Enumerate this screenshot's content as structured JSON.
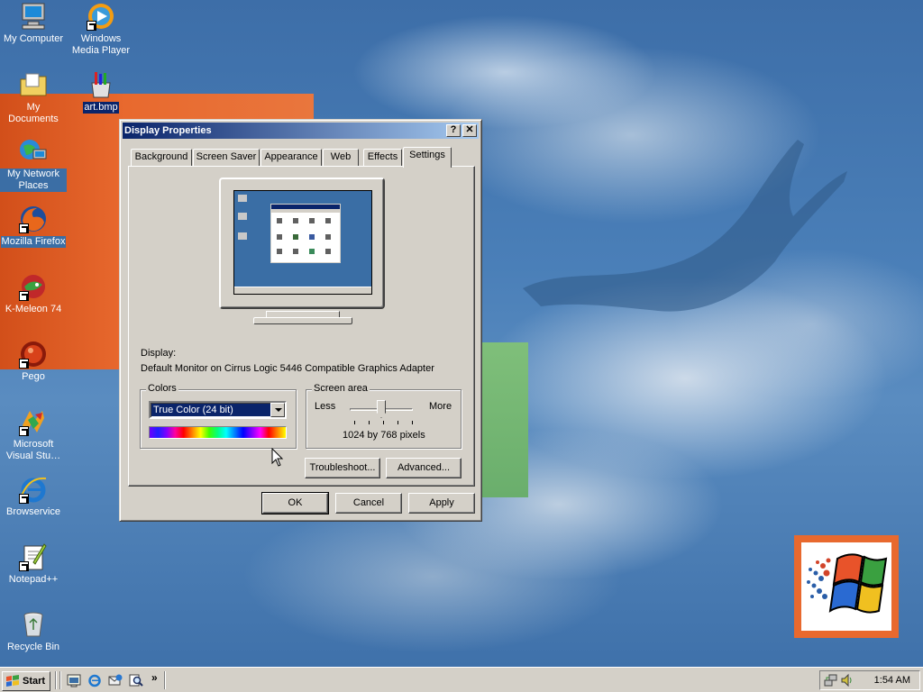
{
  "desktop": {
    "icons": [
      {
        "label": "My Computer",
        "icon": "my-computer-icon"
      },
      {
        "label": "Windows Media Player",
        "icon": "media-player-icon"
      },
      {
        "label": "My Documents",
        "icon": "my-documents-icon"
      },
      {
        "label": "art.bmp",
        "icon": "paint-bitmap-icon"
      },
      {
        "label": "My Network Places",
        "icon": "network-places-icon"
      },
      {
        "label": "Mozilla Firefox",
        "icon": "firefox-icon"
      },
      {
        "label": "K-Meleon 74",
        "icon": "k-meleon-icon"
      },
      {
        "label": "Pego",
        "icon": "pego-icon"
      },
      {
        "label": "Microsoft Visual Stu…",
        "icon": "visual-studio-icon"
      },
      {
        "label": "Browservice",
        "icon": "internet-explorer-icon"
      },
      {
        "label": "Notepad++",
        "icon": "notepad-plus-plus-icon"
      },
      {
        "label": "Recycle Bin",
        "icon": "recycle-bin-icon"
      }
    ]
  },
  "dialog": {
    "title": "Display Properties",
    "help_label": "?",
    "close_label": "✕",
    "tabs": [
      {
        "label": "Background"
      },
      {
        "label": "Screen Saver"
      },
      {
        "label": "Appearance"
      },
      {
        "label": "Web"
      },
      {
        "label": "Effects"
      },
      {
        "label": "Settings",
        "active": true
      }
    ],
    "display_label": "Display:",
    "display_value": "Default Monitor on Cirrus Logic 5446 Compatible Graphics Adapter",
    "colors": {
      "legend": "Colors",
      "selected": "True Color (24 bit)"
    },
    "screen_area": {
      "legend": "Screen area",
      "less": "Less",
      "more": "More",
      "value_text": "1024 by 768 pixels"
    },
    "troubleshoot_label": "Troubleshoot...",
    "advanced_label": "Advanced...",
    "ok_label": "OK",
    "cancel_label": "Cancel",
    "apply_label": "Apply"
  },
  "taskbar": {
    "start_label": "Start",
    "quick_launch": [
      "show-desktop-icon",
      "internet-explorer-icon",
      "outlook-express-icon",
      "search-icon"
    ],
    "more_label": "»",
    "clock": "1:54 AM"
  },
  "colors": {
    "desktop": "#3b6ea5",
    "window_face": "#d4d0c8",
    "title_active": "#0a246a",
    "title_gradient_end": "#a6caf0",
    "wallpaper_orange": "#e8692e"
  }
}
